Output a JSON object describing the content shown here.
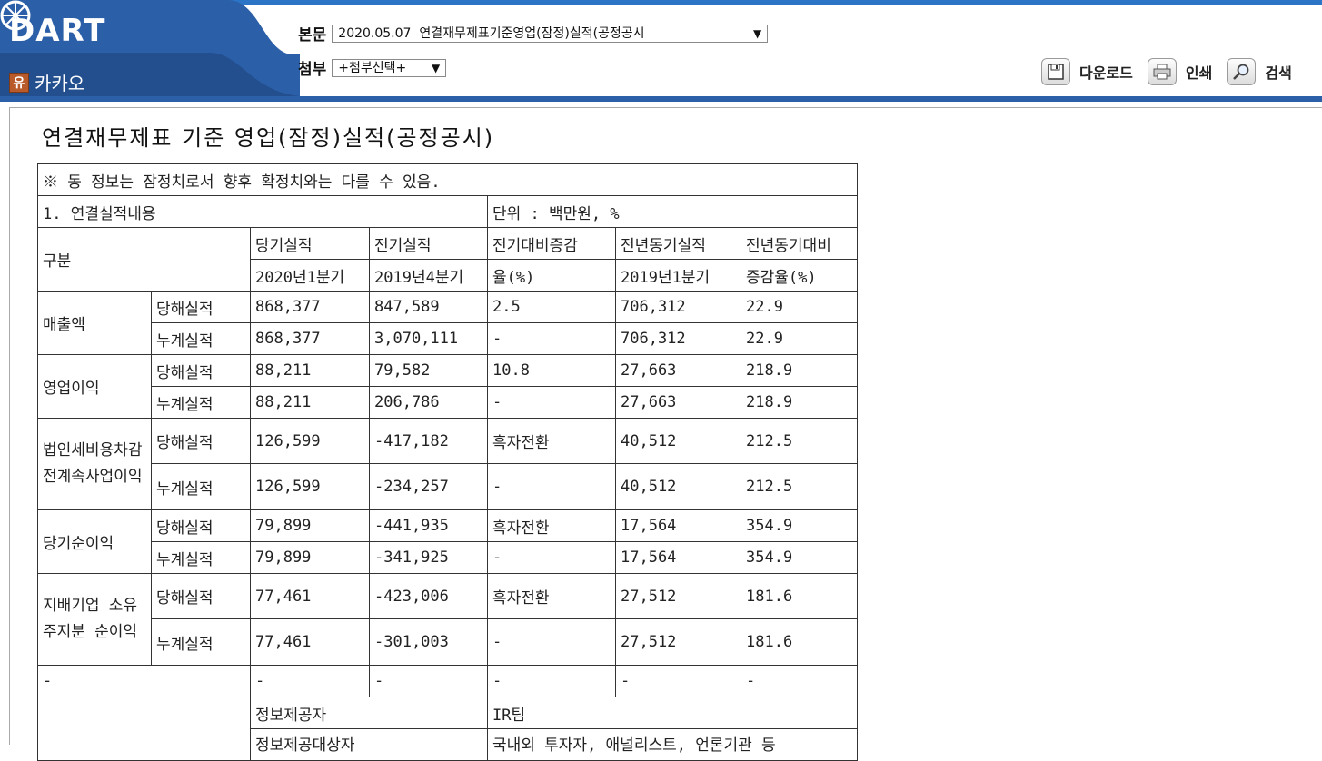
{
  "header": {
    "logo_text": "DART",
    "company_badge": "유",
    "company_name": "카카오",
    "body_label": "본문",
    "body_select": "2020.05.07  연결재무제표기준영업(잠정)실적(공정공시",
    "attach_label": "첨부",
    "attach_select": "+첨부선택+",
    "download_label": "다운로드",
    "print_label": "인쇄",
    "search_label": "검색"
  },
  "doc": {
    "title": "연결재무제표 기준 영업(잠정)실적(공정공시)",
    "notice": "※ 동 정보는 잠정치로서 향후 확정치와는 다를 수 있음.",
    "section": "1. 연결실적내용",
    "unit": "단위 : 백만원, %",
    "col_gubun": "구분",
    "col_current": "당기실적",
    "col_current_period": "2020년1분기",
    "col_prev": "전기실적",
    "col_prev_period": "2019년4분기",
    "col_qoq_1": "전기대비증감",
    "col_qoq_2": "율(%)",
    "col_yoy_actual": "전년동기실적",
    "col_yoy_period": "2019년1분기",
    "col_yoy_rate_1": "전년동기대비",
    "col_yoy_rate_2": "증감율(%)",
    "rows": [
      {
        "label": "매출액",
        "quarter": {
          "sub": "당해실적",
          "cur": "868,377",
          "prev": "847,589",
          "qoq": "2.5",
          "yoy": "706,312",
          "rate": "22.9"
        },
        "cum": {
          "sub": "누계실적",
          "cur": "868,377",
          "prev": "3,070,111",
          "qoq": "-",
          "yoy": "706,312",
          "rate": "22.9"
        }
      },
      {
        "label": "영업이익",
        "quarter": {
          "sub": "당해실적",
          "cur": "88,211",
          "prev": "79,582",
          "qoq": "10.8",
          "yoy": "27,663",
          "rate": "218.9"
        },
        "cum": {
          "sub": "누계실적",
          "cur": "88,211",
          "prev": "206,786",
          "qoq": "-",
          "yoy": "27,663",
          "rate": "218.9"
        }
      },
      {
        "label": "법인세비용차감전계속사업이익",
        "quarter": {
          "sub": "당해실적",
          "cur": "126,599",
          "prev": "-417,182",
          "qoq": "흑자전환",
          "yoy": "40,512",
          "rate": "212.5"
        },
        "cum": {
          "sub": "누계실적",
          "cur": "126,599",
          "prev": "-234,257",
          "qoq": "-",
          "yoy": "40,512",
          "rate": "212.5"
        }
      },
      {
        "label": "당기순이익",
        "quarter": {
          "sub": "당해실적",
          "cur": "79,899",
          "prev": "-441,935",
          "qoq": "흑자전환",
          "yoy": "17,564",
          "rate": "354.9"
        },
        "cum": {
          "sub": "누계실적",
          "cur": "79,899",
          "prev": "-341,925",
          "qoq": "-",
          "yoy": "17,564",
          "rate": "354.9"
        }
      },
      {
        "label": "지배기업 소유주지분 순이익",
        "quarter": {
          "sub": "당해실적",
          "cur": "77,461",
          "prev": "-423,006",
          "qoq": "흑자전환",
          "yoy": "27,512",
          "rate": "181.6"
        },
        "cum": {
          "sub": "누계실적",
          "cur": "77,461",
          "prev": "-301,003",
          "qoq": "-",
          "yoy": "27,512",
          "rate": "181.6"
        }
      }
    ],
    "dash_row": {
      "label": "-",
      "cur": "-",
      "prev": "-",
      "qoq": "-",
      "yoy": "-",
      "rate": "-"
    },
    "provider_label": "정보제공자",
    "provider_value": "IR팀",
    "target_label": "정보제공대상자",
    "target_value": "국내외 투자자, 애널리스트, 언론기관 등"
  },
  "colors": {
    "header_blue": "#2b5fa8",
    "accent": "#2b74c6",
    "badge": "#b85a2a"
  }
}
